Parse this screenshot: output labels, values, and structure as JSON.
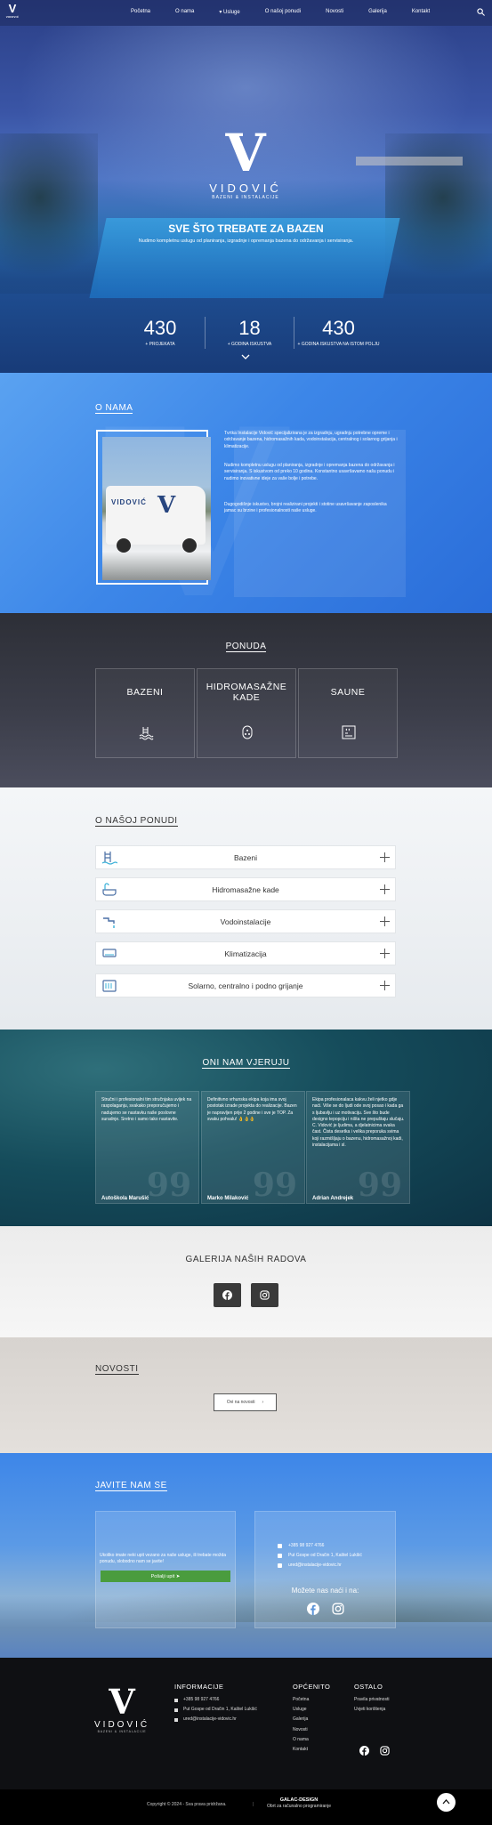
{
  "nav": {
    "brand": "V",
    "brand_sub": "VIDOVIĆ",
    "items": [
      "Početna",
      "O nama",
      "▾ Usluge",
      "O našoj ponudi",
      "Novosti",
      "Galerija",
      "Kontakt"
    ]
  },
  "hero": {
    "logo_mark": "V",
    "logo_name": "VIDOVIĆ",
    "logo_sub": "BAZENI & INSTALACIJE",
    "title": "SVE ŠTO TREBATE ZA BAZEN",
    "lead": "Nudimo kompletnu uslugu od planiranja, izgradnje i opremanja bazena do održavanja i servisiranja.",
    "stats": [
      {
        "num": "430",
        "label": "+ PROJEKATA"
      },
      {
        "num": "18",
        "label": "+ GODINA ISKUSTVA"
      },
      {
        "num": "430",
        "label": "+ GODINA ISKUSTVA NA ISTOM POLJU"
      }
    ]
  },
  "about": {
    "title": "O NAMA",
    "photo_text": "VIDOVIĆ",
    "p1": "Tvrtka Instalacije Vidović specijalizirana je za izgradnju, ugradnju potrebne opreme i održavanje bazena, hidromasažnih kada, vodoinstalacija, centralnog i solarnog grijanja i klimatizacije.",
    "p2": "Nudimo kompletnu uslugu od planiranja, izgradnje i opremanja bazena do održavanja i servisiranja. S iskustvom od preko 10 godina. Konstantno usavršavamo našu ponudu i nudimo inovativne ideje za vaše bolje i potrebe.",
    "p3": "Dugogodišnje iskustvo, brojni realizirani projekti i stotine usavršavanje zaposlenika jamac su brzine i profesionalnosti naše usluge."
  },
  "ponuda": {
    "title": "PONUDA",
    "cards": [
      "BAZENI",
      "HIDROMASAŽNE KADE",
      "SAUNE"
    ]
  },
  "onp": {
    "title": "O NAŠOJ PONUDI",
    "items": [
      "Bazeni",
      "Hidromasažne kade",
      "Vodoinstalacije",
      "Klimatizacija",
      "Solarno, centralno i podno grijanje"
    ]
  },
  "testimonials": {
    "title": "ONI NAM VJERUJU",
    "quote_mark": "99",
    "items": [
      {
        "text": "Stručni i profesionalni tim stručnjaka uvijek na raspolaganju, svakako preporučujemo i nadujemo se nastavku naše poslovne suradnje. Sretno i samo tako nastavite.",
        "name": "Autoškola Marušić"
      },
      {
        "text": "Definitivno vrhunska ekipa koja ima svoj postotak izrade projekta do realizacije. Bazen je napravljen prije 2 godine i sve je TOP. Za svaku pohvalu! 👌👌👌",
        "name": "Marko Milaković"
      },
      {
        "text": "Ekipa profesionalaca kakvu želi njetko gdje naći. Više se do ljudi ode svoj posao i kada ga s ljubavlju i uz motivaciju. Sve što bude dexigno tepopciju i ništa ne prepuštaju slučaju. C. Vidović je ljudima, a djelatnicima svaka čast. Čista desetka i velika preporuka svima koji razmišljaju o bazenu, hidromasažnoj kadi, instalacijama i sl.",
        "name": "Adrian Andrejek"
      }
    ]
  },
  "gallery": {
    "title": "GALERIJA NAŠIH RADOVA"
  },
  "novosti": {
    "title": "NOVOSTI",
    "button": "Ovi na novosti"
  },
  "contact": {
    "title": "JAVITE NAM SE",
    "message": "Ukoliko imate neki upit vezano za naše usluge, ili trebate možda ponudu, slobodno nam se javite!",
    "send": "Pošalji upit ➤",
    "phone": "+385 98 927 4766",
    "address": "Put Gospe od Dračin 1, Kaštel Lukšić",
    "email": "ured@instalacije-vidovic.hr",
    "find": "Možete nas naći i na:"
  },
  "footer": {
    "logo_mark": "V",
    "logo_name": "VIDOVIĆ",
    "logo_sub": "BAZENI & INSTALACIJE",
    "info_title": "INFORMACIJE",
    "phone": "+385 98 927 4766",
    "address": "Put Gospe od Dračin 1, Kaštel Lukšić",
    "email": "ured@instalacije-vidovic.hr",
    "general_title": "OPĆENITO",
    "general": [
      "Početna",
      "Usluge",
      "Galerija",
      "Novosti",
      "O nama",
      "Kontakt"
    ],
    "other_title": "OSTALO",
    "other": [
      "Pravila privatnosti",
      "Uvjeti korištenja"
    ]
  },
  "bottom": {
    "copyright": "Copyright © 2024 - Sva prava pridržana.",
    "sep": "|",
    "dev_name": "GALAC-DESIGN",
    "dev_text": "Obrt za računalno programiranje"
  },
  "colors": {
    "accent": "#3c86e8",
    "send": "#4a9c3e",
    "footer": "#0f1013"
  }
}
